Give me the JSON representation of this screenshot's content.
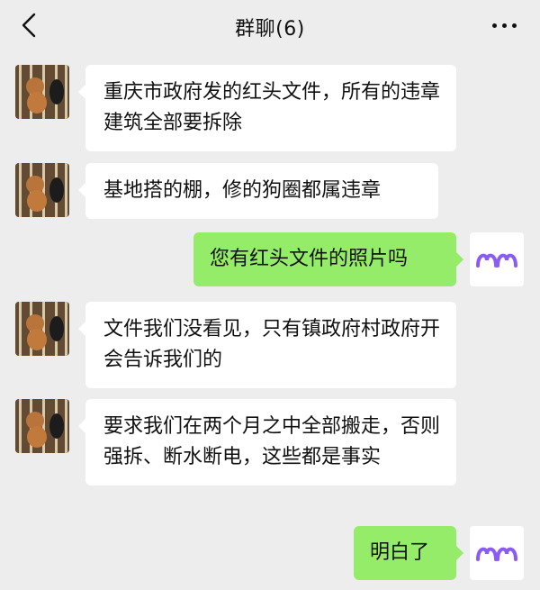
{
  "header": {
    "title": "群聊(6)",
    "back_icon": "chevron-left-icon",
    "more_icon": "ellipsis-icon"
  },
  "messages": [
    {
      "side": "left",
      "text": "重庆市政府发的红头文件，所有的违章建筑全部要拆除"
    },
    {
      "side": "left",
      "text": "基地搭的棚，修的狗圈都属违章"
    },
    {
      "side": "right",
      "text": "您有红头文件的照片吗"
    },
    {
      "side": "left",
      "text": "文件我们没看见，只有镇政府村政府开会告诉我们的"
    },
    {
      "side": "left",
      "text": "要求我们在两个月之中全部搬走，否则强拆、断水断电，这些都是事实"
    },
    {
      "side": "right",
      "text": "明白了"
    }
  ],
  "colors": {
    "background": "#ededed",
    "incoming_bubble": "#ffffff",
    "outgoing_bubble": "#95ec69",
    "self_avatar_logo": "#8a5cf5"
  }
}
